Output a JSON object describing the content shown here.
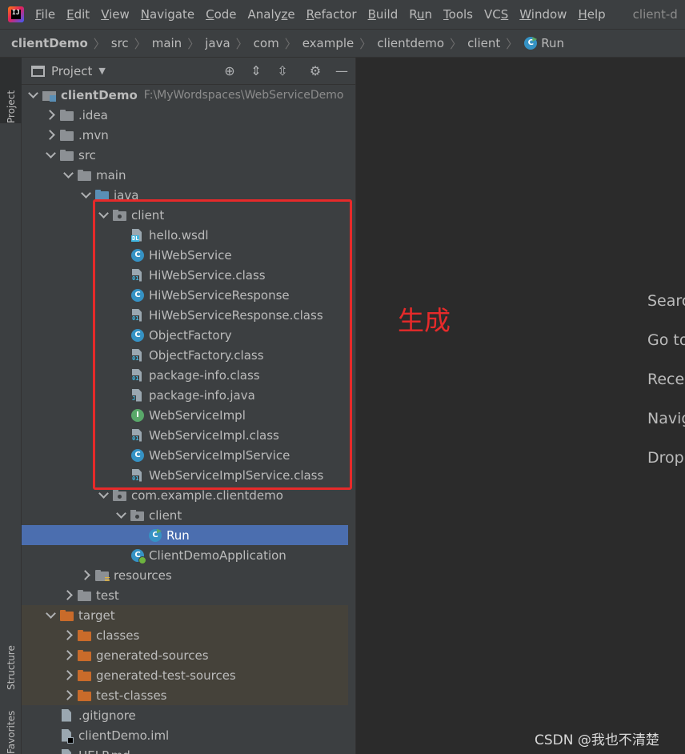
{
  "menubar": {
    "items": [
      {
        "label": "File",
        "mnemonic": "F"
      },
      {
        "label": "Edit",
        "mnemonic": "E"
      },
      {
        "label": "View",
        "mnemonic": "V"
      },
      {
        "label": "Navigate",
        "mnemonic": "N"
      },
      {
        "label": "Code",
        "mnemonic": "C"
      },
      {
        "label": "Analyze",
        "mnemonic": "z"
      },
      {
        "label": "Refactor",
        "mnemonic": "R"
      },
      {
        "label": "Build",
        "mnemonic": "B"
      },
      {
        "label": "Run",
        "mnemonic": "u"
      },
      {
        "label": "Tools",
        "mnemonic": "T"
      },
      {
        "label": "VCS",
        "mnemonic": "S"
      },
      {
        "label": "Window",
        "mnemonic": "W"
      },
      {
        "label": "Help",
        "mnemonic": "H"
      }
    ],
    "window_title": "client-d"
  },
  "breadcrumb": [
    "clientDemo",
    "src",
    "main",
    "java",
    "com",
    "example",
    "clientdemo",
    "client",
    "Run"
  ],
  "left_strip": {
    "project_tab": "Project",
    "structure_tab": "Structure",
    "favorites_tab": "Favorites"
  },
  "project_panel": {
    "title": "Project",
    "tree": [
      {
        "label": "clientDemo",
        "hint": "F:\\MyWordspaces\\WebServiceDemo",
        "depth": 0,
        "arrow": "open",
        "icon": "module",
        "bold": true
      },
      {
        "label": ".idea",
        "depth": 1,
        "arrow": "closed",
        "icon": "folder"
      },
      {
        "label": ".mvn",
        "depth": 1,
        "arrow": "closed",
        "icon": "folder"
      },
      {
        "label": "src",
        "depth": 1,
        "arrow": "open",
        "icon": "folder"
      },
      {
        "label": "main",
        "depth": 2,
        "arrow": "open",
        "icon": "folder"
      },
      {
        "label": "java",
        "depth": 3,
        "arrow": "open",
        "icon": "folder-src"
      },
      {
        "label": "client",
        "depth": 4,
        "arrow": "open",
        "icon": "package"
      },
      {
        "label": "hello.wsdl",
        "depth": 5,
        "arrow": "none",
        "icon": "file-dl"
      },
      {
        "label": "HiWebService",
        "depth": 5,
        "arrow": "none",
        "icon": "class"
      },
      {
        "label": "HiWebService.class",
        "depth": 5,
        "arrow": "none",
        "icon": "file-01"
      },
      {
        "label": "HiWebServiceResponse",
        "depth": 5,
        "arrow": "none",
        "icon": "class"
      },
      {
        "label": "HiWebServiceResponse.class",
        "depth": 5,
        "arrow": "none",
        "icon": "file-01"
      },
      {
        "label": "ObjectFactory",
        "depth": 5,
        "arrow": "none",
        "icon": "class"
      },
      {
        "label": "ObjectFactory.class",
        "depth": 5,
        "arrow": "none",
        "icon": "file-01"
      },
      {
        "label": "package-info.class",
        "depth": 5,
        "arrow": "none",
        "icon": "file-01"
      },
      {
        "label": "package-info.java",
        "depth": 5,
        "arrow": "none",
        "icon": "file-j"
      },
      {
        "label": "WebServiceImpl",
        "depth": 5,
        "arrow": "none",
        "icon": "interface"
      },
      {
        "label": "WebServiceImpl.class",
        "depth": 5,
        "arrow": "none",
        "icon": "file-01"
      },
      {
        "label": "WebServiceImplService",
        "depth": 5,
        "arrow": "none",
        "icon": "class"
      },
      {
        "label": "WebServiceImplService.class",
        "depth": 5,
        "arrow": "none",
        "icon": "file-01"
      },
      {
        "label": "com.example.clientdemo",
        "depth": 4,
        "arrow": "open",
        "icon": "package"
      },
      {
        "label": "client",
        "depth": 5,
        "arrow": "open",
        "icon": "package"
      },
      {
        "label": "Run",
        "depth": 6,
        "arrow": "none",
        "icon": "run-class",
        "selected": true
      },
      {
        "label": "ClientDemoApplication",
        "depth": 5,
        "arrow": "none",
        "icon": "boot-class"
      },
      {
        "label": "resources",
        "depth": 3,
        "arrow": "closed",
        "icon": "folder-res"
      },
      {
        "label": "test",
        "depth": 2,
        "arrow": "closed",
        "icon": "folder"
      },
      {
        "label": "target",
        "depth": 1,
        "arrow": "open",
        "icon": "folder-orange",
        "excluded": true
      },
      {
        "label": "classes",
        "depth": 2,
        "arrow": "closed",
        "icon": "folder-orange",
        "excluded": true
      },
      {
        "label": "generated-sources",
        "depth": 2,
        "arrow": "closed",
        "icon": "folder-orange",
        "excluded": true
      },
      {
        "label": "generated-test-sources",
        "depth": 2,
        "arrow": "closed",
        "icon": "folder-orange",
        "excluded": true
      },
      {
        "label": "test-classes",
        "depth": 2,
        "arrow": "closed",
        "icon": "folder-orange",
        "excluded": true
      },
      {
        "label": ".gitignore",
        "depth": 1,
        "arrow": "none",
        "icon": "file"
      },
      {
        "label": "clientDemo.iml",
        "depth": 1,
        "arrow": "none",
        "icon": "file-iml"
      },
      {
        "label": "HELP.md",
        "depth": 1,
        "arrow": "none",
        "icon": "file"
      }
    ]
  },
  "editor_hints": [
    "Searc",
    "Go to",
    "Recer",
    "Navig",
    "Drop"
  ],
  "annotation": {
    "text": "生成",
    "color": "#e62a2a"
  },
  "watermark": "CSDN @我也不清楚",
  "colors": {
    "selection": "#4b6eaf",
    "excluded_bg": "#45423a",
    "panel_bg": "#3c3f41",
    "editor_bg": "#2b2b2b"
  }
}
